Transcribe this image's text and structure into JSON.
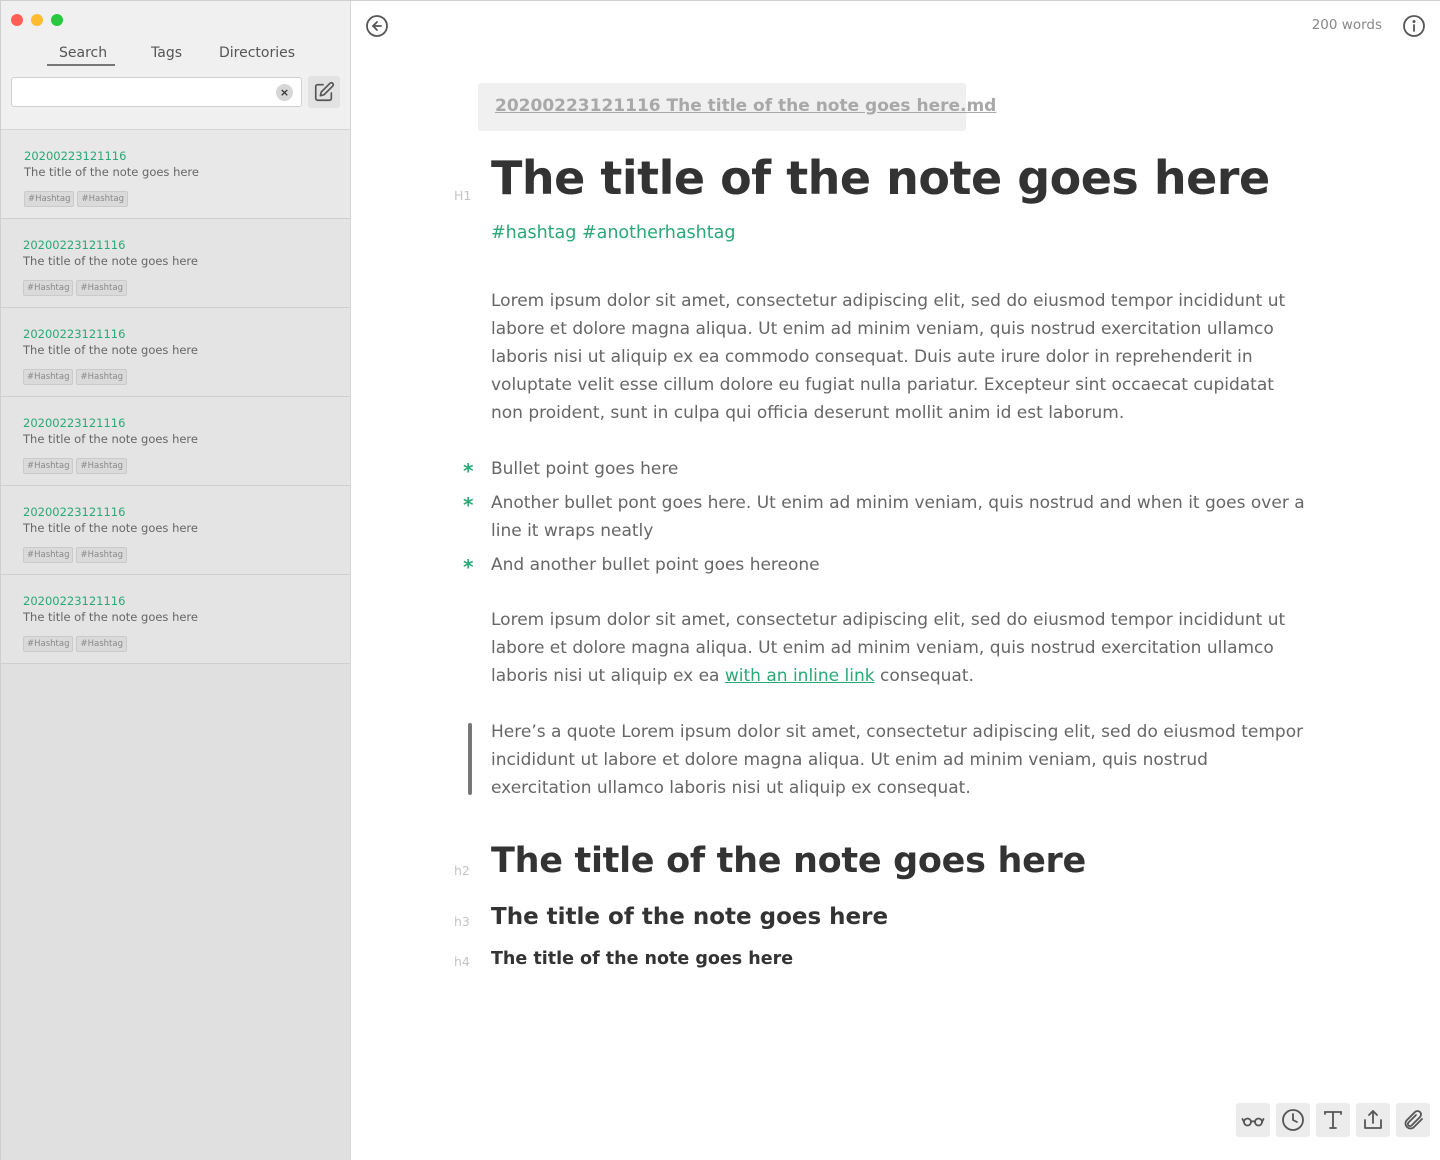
{
  "sidebar": {
    "tabs": [
      {
        "label": "Search"
      },
      {
        "label": "Tags"
      },
      {
        "label": "Directories"
      }
    ],
    "search": {
      "value": "",
      "placeholder": ""
    },
    "notes": [
      {
        "id": "20200223121116",
        "title": "The title of the note goes here",
        "tags": [
          "#Hashtag",
          "#Hashtag"
        ]
      },
      {
        "id": "20200223121116",
        "title": "The title of the note goes here",
        "tags": [
          "#Hashtag",
          "#Hashtag"
        ]
      },
      {
        "id": "20200223121116",
        "title": "The title of the note goes here",
        "tags": [
          "#Hashtag",
          "#Hashtag"
        ]
      },
      {
        "id": "20200223121116",
        "title": "The title of the note goes here",
        "tags": [
          "#Hashtag",
          "#Hashtag"
        ]
      },
      {
        "id": "20200223121116",
        "title": "The title of the note goes here",
        "tags": [
          "#Hashtag",
          "#Hashtag"
        ]
      },
      {
        "id": "20200223121116",
        "title": "The title of the note goes here",
        "tags": [
          "#Hashtag",
          "#Hashtag"
        ]
      }
    ]
  },
  "header": {
    "word_count": "200 words"
  },
  "editor": {
    "filename": "20200223121116 The title of the note goes here.md",
    "h1_marker": "H1",
    "h1": "The title of the note goes here",
    "hashtags": "#hashtag #anotherhashtag",
    "paragraph1": "Lorem ipsum dolor sit amet, consectetur adipiscing elit, sed do eiusmod tempor incididunt ut labore et dolore magna aliqua. Ut enim ad minim veniam, quis nostrud exercitation ullamco laboris nisi ut aliquip ex ea commodo consequat. Duis aute irure dolor in reprehenderit in voluptate velit esse cillum dolore eu fugiat nulla pariatur. Excepteur sint occaecat cupidatat non proident, sunt in culpa qui officia deserunt mollit anim id est laborum.",
    "bullet_marker": "*",
    "bullets": [
      "Bullet point goes here",
      "Another bullet pont goes here. Ut enim ad minim veniam, quis nostrud and when it goes over a line it wraps neatly",
      "And another bullet point goes hereone"
    ],
    "paragraph2_before": "Lorem ipsum dolor sit amet, consectetur adipiscing elit, sed do eiusmod tempor incididunt ut labore et dolore magna aliqua. Ut enim ad minim veniam, quis nostrud exercitation ullamco laboris nisi ut aliquip ex ea ",
    "paragraph2_link": "with an inline link",
    "paragraph2_after": " consequat.",
    "quote": "Here’s a quote Lorem ipsum dolor sit amet, consectetur adipiscing elit, sed do eiusmod tempor incididunt ut labore et dolore magna aliqua. Ut enim ad minim veniam, quis nostrud exercitation ullamco laboris nisi ut aliquip ex consequat.",
    "h2_marker": "h2",
    "h2": "The title of the note goes here",
    "h3_marker": "h3",
    "h3": "The title of the note goes here",
    "h4_marker": "h4",
    "h4": "The title of the note goes here"
  },
  "toolbar": {
    "icons": [
      "glasses-icon",
      "clock-icon",
      "text-format-icon",
      "share-icon",
      "paperclip-icon"
    ]
  },
  "colors": {
    "accent": "#2aa876",
    "sidebar_bg": "#e0e0e0",
    "text": "#666666"
  }
}
